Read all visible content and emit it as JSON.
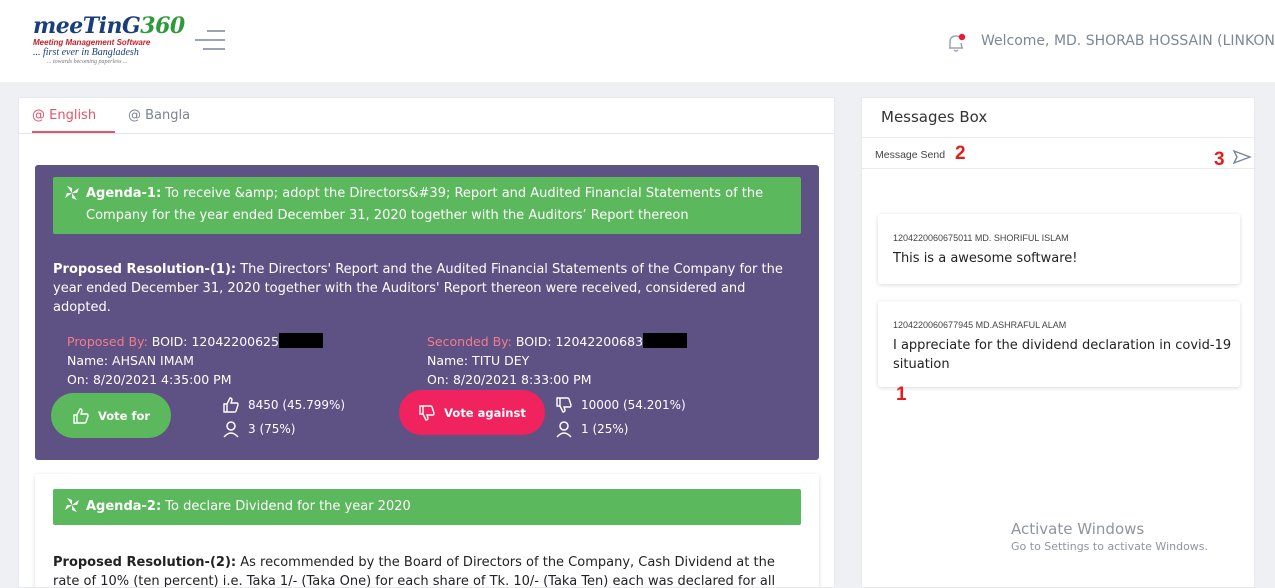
{
  "header": {
    "logo": {
      "main_a": "meeTinG",
      "main_b": "360",
      "sub": "Meeting Management Software",
      "tagline": "... first ever in Bangladesh",
      "tagline2": "... towards becoming paperless ..."
    },
    "welcome": "Welcome, MD. SHORAB HOSSAIN (LINKON)"
  },
  "tabs": [
    {
      "label": "@ English",
      "active": true
    },
    {
      "label": "@ Bangla",
      "active": false
    }
  ],
  "agendas": [
    {
      "title_label": "Agenda-1:",
      "title_text": " To receive &amp; adopt the Directors&#39; Report and Audited Financial Statements of the Company for the year ended December 31, 2020 together with the Auditors’ Report thereon",
      "resolution_label": "Proposed Resolution-(1):",
      "resolution_text": " The Directors' Report and the Audited Financial Statements of the Company for the year ended December 31, 2020 together with the Auditors' Report thereon were received, considered and adopted.",
      "proposed": {
        "label": "Proposed By:",
        "boid": " BOID: 12042200625",
        "name": "Name: AHSAN IMAM",
        "on": "On: 8/20/2021 4:35:00 PM"
      },
      "seconded": {
        "label": "Seconded By:",
        "boid": " BOID: 12042200683",
        "name": "Name: TITU DEY",
        "on": "On: 8/20/2021 8:33:00 PM"
      },
      "vote_for_label": "Vote for",
      "vote_against_label": "Vote against",
      "for_shares": "8450 (45.799%)",
      "for_voters": "3 (75%)",
      "against_shares": "10000 (54.201%)",
      "against_voters": "1 (25%)"
    },
    {
      "title_label": "Agenda-2:",
      "title_text": " To declare Dividend for the year 2020",
      "resolution_label": "Proposed Resolution-(2):",
      "resolution_text": " As recommended by the Board of Directors of the Company, Cash Dividend at the rate of 10% (ten percent) i.e. Taka 1/- (Taka One) for each share of Tk. 10/- (Taka Ten) each was declared for all"
    }
  ],
  "messages_box": {
    "title": "Messages Box",
    "input_placeholder": "Message Send",
    "messages": [
      {
        "meta": "1204220060675011 MD. SHORIFUL ISLAM",
        "text": "This is a awesome software!"
      },
      {
        "meta": "1204220060677945 MD.ASHRAFUL ALAM",
        "text": "I appreciate for the dividend declaration in covid-19 situation"
      }
    ]
  },
  "annotations": [
    "1",
    "2",
    "3"
  ],
  "watermark": {
    "line1": "Activate Windows",
    "line2": "Go to Settings to activate Windows."
  },
  "colors": {
    "accent": "#e2546a",
    "agenda_bg": "#5e5184",
    "green": "#5cb85c",
    "against": "#f0235e"
  }
}
